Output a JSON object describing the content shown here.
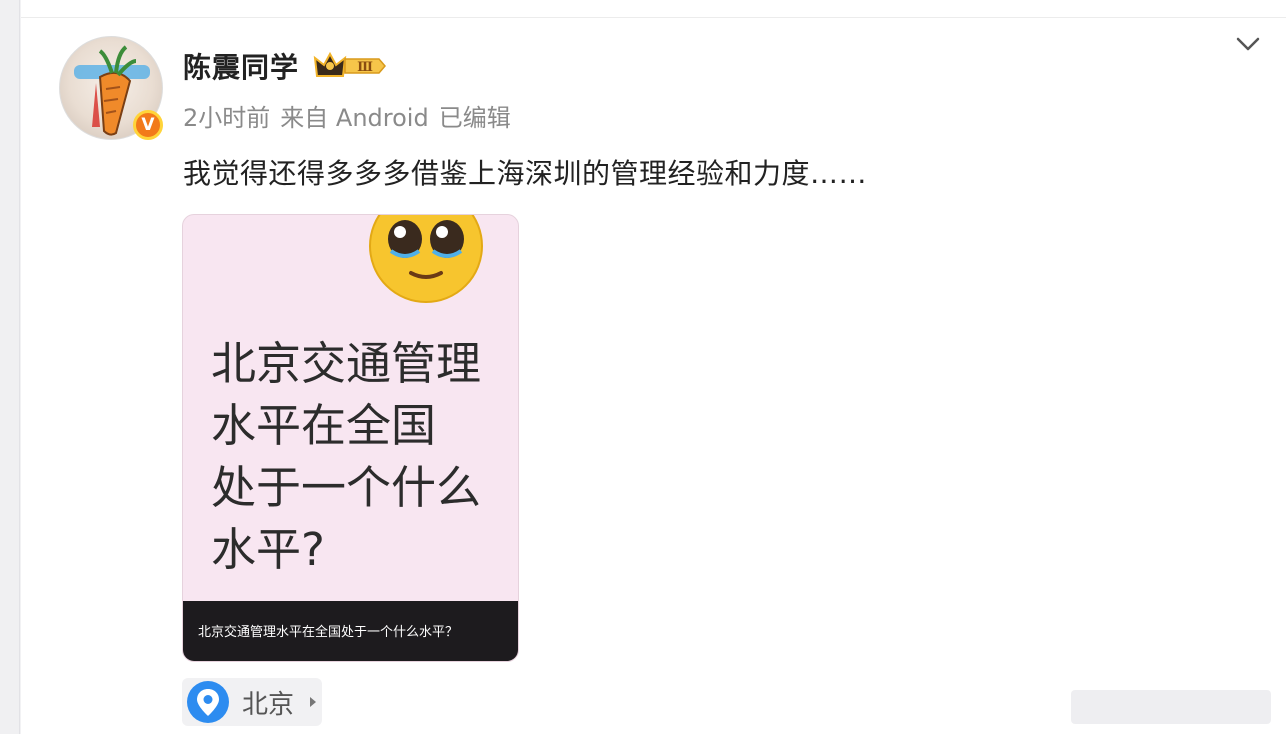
{
  "post": {
    "username": "陈震同学",
    "vip_level": "Ⅲ",
    "verified_badge": "V",
    "meta": {
      "time": "2小时前",
      "source": "来自 Android",
      "edited": "已编辑"
    },
    "text": "我觉得还得多多多借鉴上海深圳的管理经验和力度……",
    "image": {
      "title": "北京交通管理水平在全国处于一个什么水平?",
      "title_lines": [
        "北京交通管理",
        "水平在全国",
        "处于一个什么",
        "水平?"
      ],
      "caption": "北京交通管理水平在全国处于一个什么水平？",
      "emoji": "pleading-face-emoji"
    },
    "location": {
      "label": "北京",
      "icon": "location-pin-icon"
    }
  },
  "icons": {
    "collapse": "chevron-down-icon",
    "crown": "crown-icon"
  },
  "colors": {
    "accent_blue": "#2d8cf0",
    "badge_orange": "#f27a1a",
    "badge_yellow": "#ffd43a",
    "image_bg": "#f8e6f1",
    "caption_bg": "#1d1b1e"
  }
}
